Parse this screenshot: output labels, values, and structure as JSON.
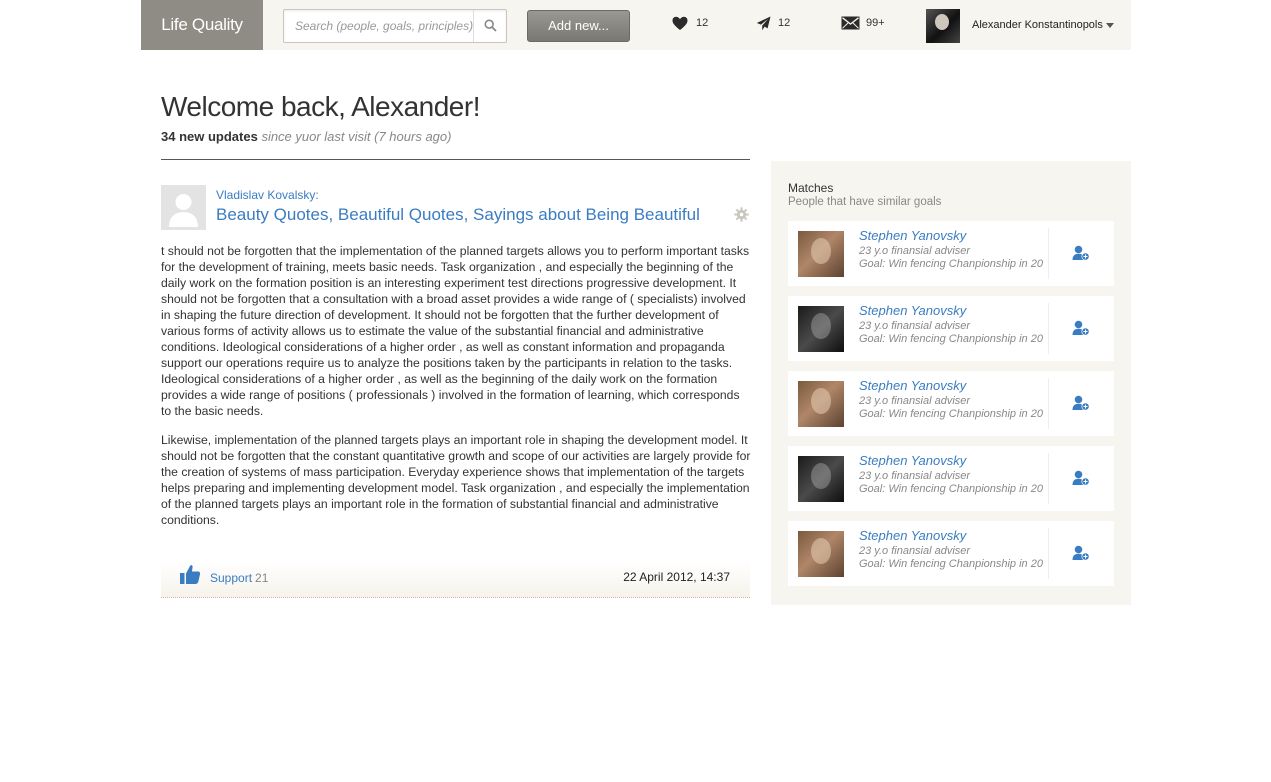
{
  "header": {
    "logo": "Life Quality",
    "search_placeholder": "Search (people, goals, principles)",
    "add_new": "Add new...",
    "likes_count": "12",
    "sends_count": "12",
    "messages_count": "99+",
    "user_name": "Alexander Konstantinopols"
  },
  "welcome": {
    "title": "Welcome back, Alexander!",
    "updates_bold": "34 new updates",
    "updates_rest": "since yuor last visit (7 hours ago)"
  },
  "post": {
    "author": "Vladislav Kovalsky:",
    "title": "Beauty Quotes, Beautiful Quotes, Sayings about Being Beautiful",
    "paragraphs": [
      "t should not be forgotten that the implementation of the planned targets allows you to perform important tasks for the development of training, meets basic needs. Task organization , and especially the beginning of the daily work on the formation position is an interesting experiment test directions progressive development. It should not be forgotten that a consultation with a broad asset provides a wide range of ( specialists) involved in shaping the future direction of development. It should not be forgotten that the further development of various forms of activity allows us to estimate the value of the substantial financial and administrative conditions. Ideological considerations of a higher order , as well as constant information and propaganda support our operations require us to analyze the positions taken by the participants in relation to the tasks. Ideological considerations of a higher order , as well as the beginning of the daily work on the formation provides a wide range of positions ( professionals ) involved in the formation of learning, which corresponds to the basic needs.",
      "Likewise, implementation of the planned targets plays an important role in shaping the development model. It should not be forgotten that the constant quantitative growth and scope of our activities are largely provide for the creation of systems of mass participation. Everyday experience shows that implementation of the targets helps preparing and implementing development model. Task organization , and especially the implementation of the planned targets plays an important role in the formation of substantial financial and administrative conditions."
    ],
    "support_label": "Support",
    "support_count": "21",
    "date": "22 April 2012, 14:37"
  },
  "sidebar": {
    "title": "Matches",
    "subtitle": "People that have similar goals",
    "matches": [
      {
        "name": "Stephen Yanovsky",
        "info": "23 y.o finansial adviser",
        "goal": "Goal: Win fencing Chanpionship in 20",
        "photo": "warm"
      },
      {
        "name": "Stephen Yanovsky",
        "info": "23 y.o finansial adviser",
        "goal": "Goal: Win fencing Chanpionship in 20",
        "photo": "dark"
      },
      {
        "name": "Stephen Yanovsky",
        "info": "23 y.o finansial adviser",
        "goal": "Goal: Win fencing Chanpionship in 20",
        "photo": "warm"
      },
      {
        "name": "Stephen Yanovsky",
        "info": "23 y.o finansial adviser",
        "goal": "Goal: Win fencing Chanpionship in 20",
        "photo": "dark"
      },
      {
        "name": "Stephen Yanovsky",
        "info": "23 y.o finansial adviser",
        "goal": "Goal: Win fencing Chanpionship in 20",
        "photo": "warm"
      }
    ]
  },
  "colors": {
    "link": "#3a7cc2",
    "header_bg": "#f7f5ef",
    "logo_bg": "#8f8c86"
  },
  "icons": [
    "search-icon",
    "heart-icon",
    "paper-plane-icon",
    "envelope-icon",
    "chevron-down-icon",
    "gear-icon",
    "thumbs-up-icon",
    "add-user-icon"
  ]
}
